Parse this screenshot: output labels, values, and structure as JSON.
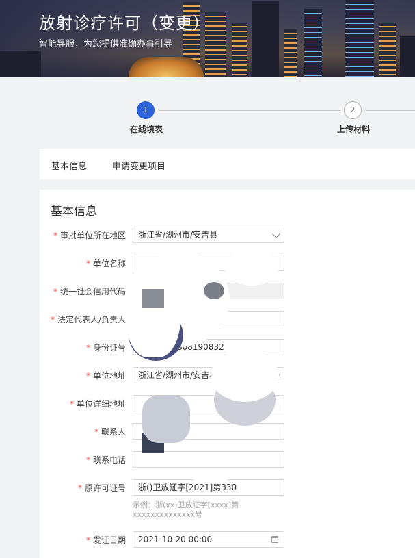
{
  "banner": {
    "title": "放射诊疗许可（变更）",
    "subtitle": "智能导服，为您提供准确办事引导"
  },
  "steps": [
    {
      "number": "1",
      "label": "在线填表",
      "state": "active"
    },
    {
      "number": "2",
      "label": "上传材料",
      "state": "pending"
    }
  ],
  "tabs": [
    {
      "label": "基本信息"
    },
    {
      "label": "申请变更项目"
    }
  ],
  "form": {
    "section_title": "基本信息",
    "fields": {
      "region": {
        "label": "审批单位所在地区",
        "value": "浙江省/湖州市/安吉县"
      },
      "unit_name": {
        "label": "单位名称",
        "value": ""
      },
      "credit_code": {
        "label": "统一社会信用代码",
        "value": "**"
      },
      "legal_person": {
        "label": "法定代表人/负责人",
        "value": ""
      },
      "id_number": {
        "label": "身份证号",
        "value": "808190832"
      },
      "address": {
        "label": "单位地址",
        "value": "浙江省/湖州市/安吉县/"
      },
      "address_detail": {
        "label": "单位详细地址",
        "value": ""
      },
      "contact": {
        "label": "联系人",
        "value": ""
      },
      "phone": {
        "label": "联系电话",
        "value": ""
      },
      "orig_license": {
        "label": "原许可证号",
        "value": "浙()卫放证字[2021]第330",
        "hint": "示例：浙(xx)卫放证字[xxxx]第xxxxxxxxxxxxxx号"
      },
      "issue_date": {
        "label": "发证日期",
        "value": "2021-10-20 00:00"
      }
    }
  },
  "colors": {
    "primary": "#2c63d9",
    "required": "#e53935"
  },
  "icons": {
    "select": "chevron-down-icon",
    "date": "calendar-icon"
  }
}
